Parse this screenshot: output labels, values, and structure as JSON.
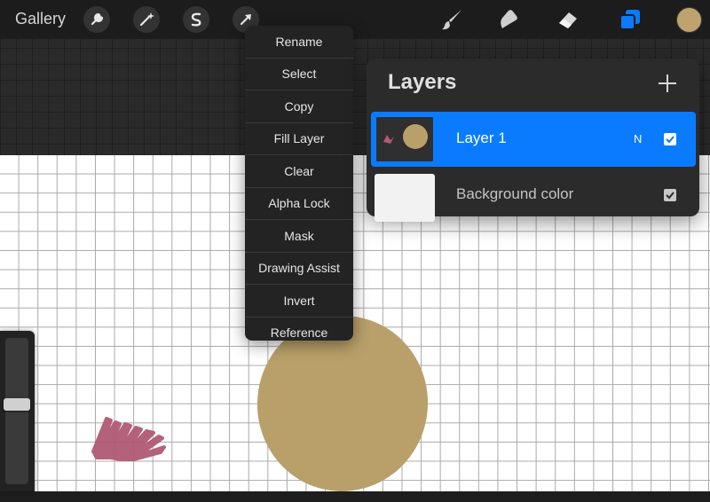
{
  "toolbar": {
    "gallery_label": "Gallery",
    "left_icons": [
      "wrench-icon",
      "magic-wand-icon",
      "selection-s-icon",
      "transform-arrow-icon"
    ],
    "right_icons": [
      "brush-icon",
      "smudge-icon",
      "eraser-icon",
      "layers-icon"
    ],
    "active_tool": "layers",
    "active_color": "#bfa36f"
  },
  "layer_menu": {
    "items": [
      "Rename",
      "Select",
      "Copy",
      "Fill Layer",
      "Clear",
      "Alpha Lock",
      "Mask",
      "Drawing Assist",
      "Invert",
      "Reference"
    ]
  },
  "layers_panel": {
    "title": "Layers",
    "add_icon": "plus-icon",
    "layers": [
      {
        "name": "Layer 1",
        "blend_mode": "N",
        "visible": true,
        "selected": true
      },
      {
        "name": "Background color",
        "visible": true,
        "selected": false
      }
    ]
  },
  "canvas": {
    "paper_color": "#ffffff",
    "grid": true,
    "strokes": [
      {
        "type": "blob",
        "color": "#b9a06a"
      },
      {
        "type": "scribble",
        "color": "#b15a76"
      }
    ]
  },
  "sliders": {
    "brush_size_level": 0.55
  },
  "colors": {
    "accent": "#0a7bff",
    "toolbar_bg": "#1c1c1c"
  }
}
